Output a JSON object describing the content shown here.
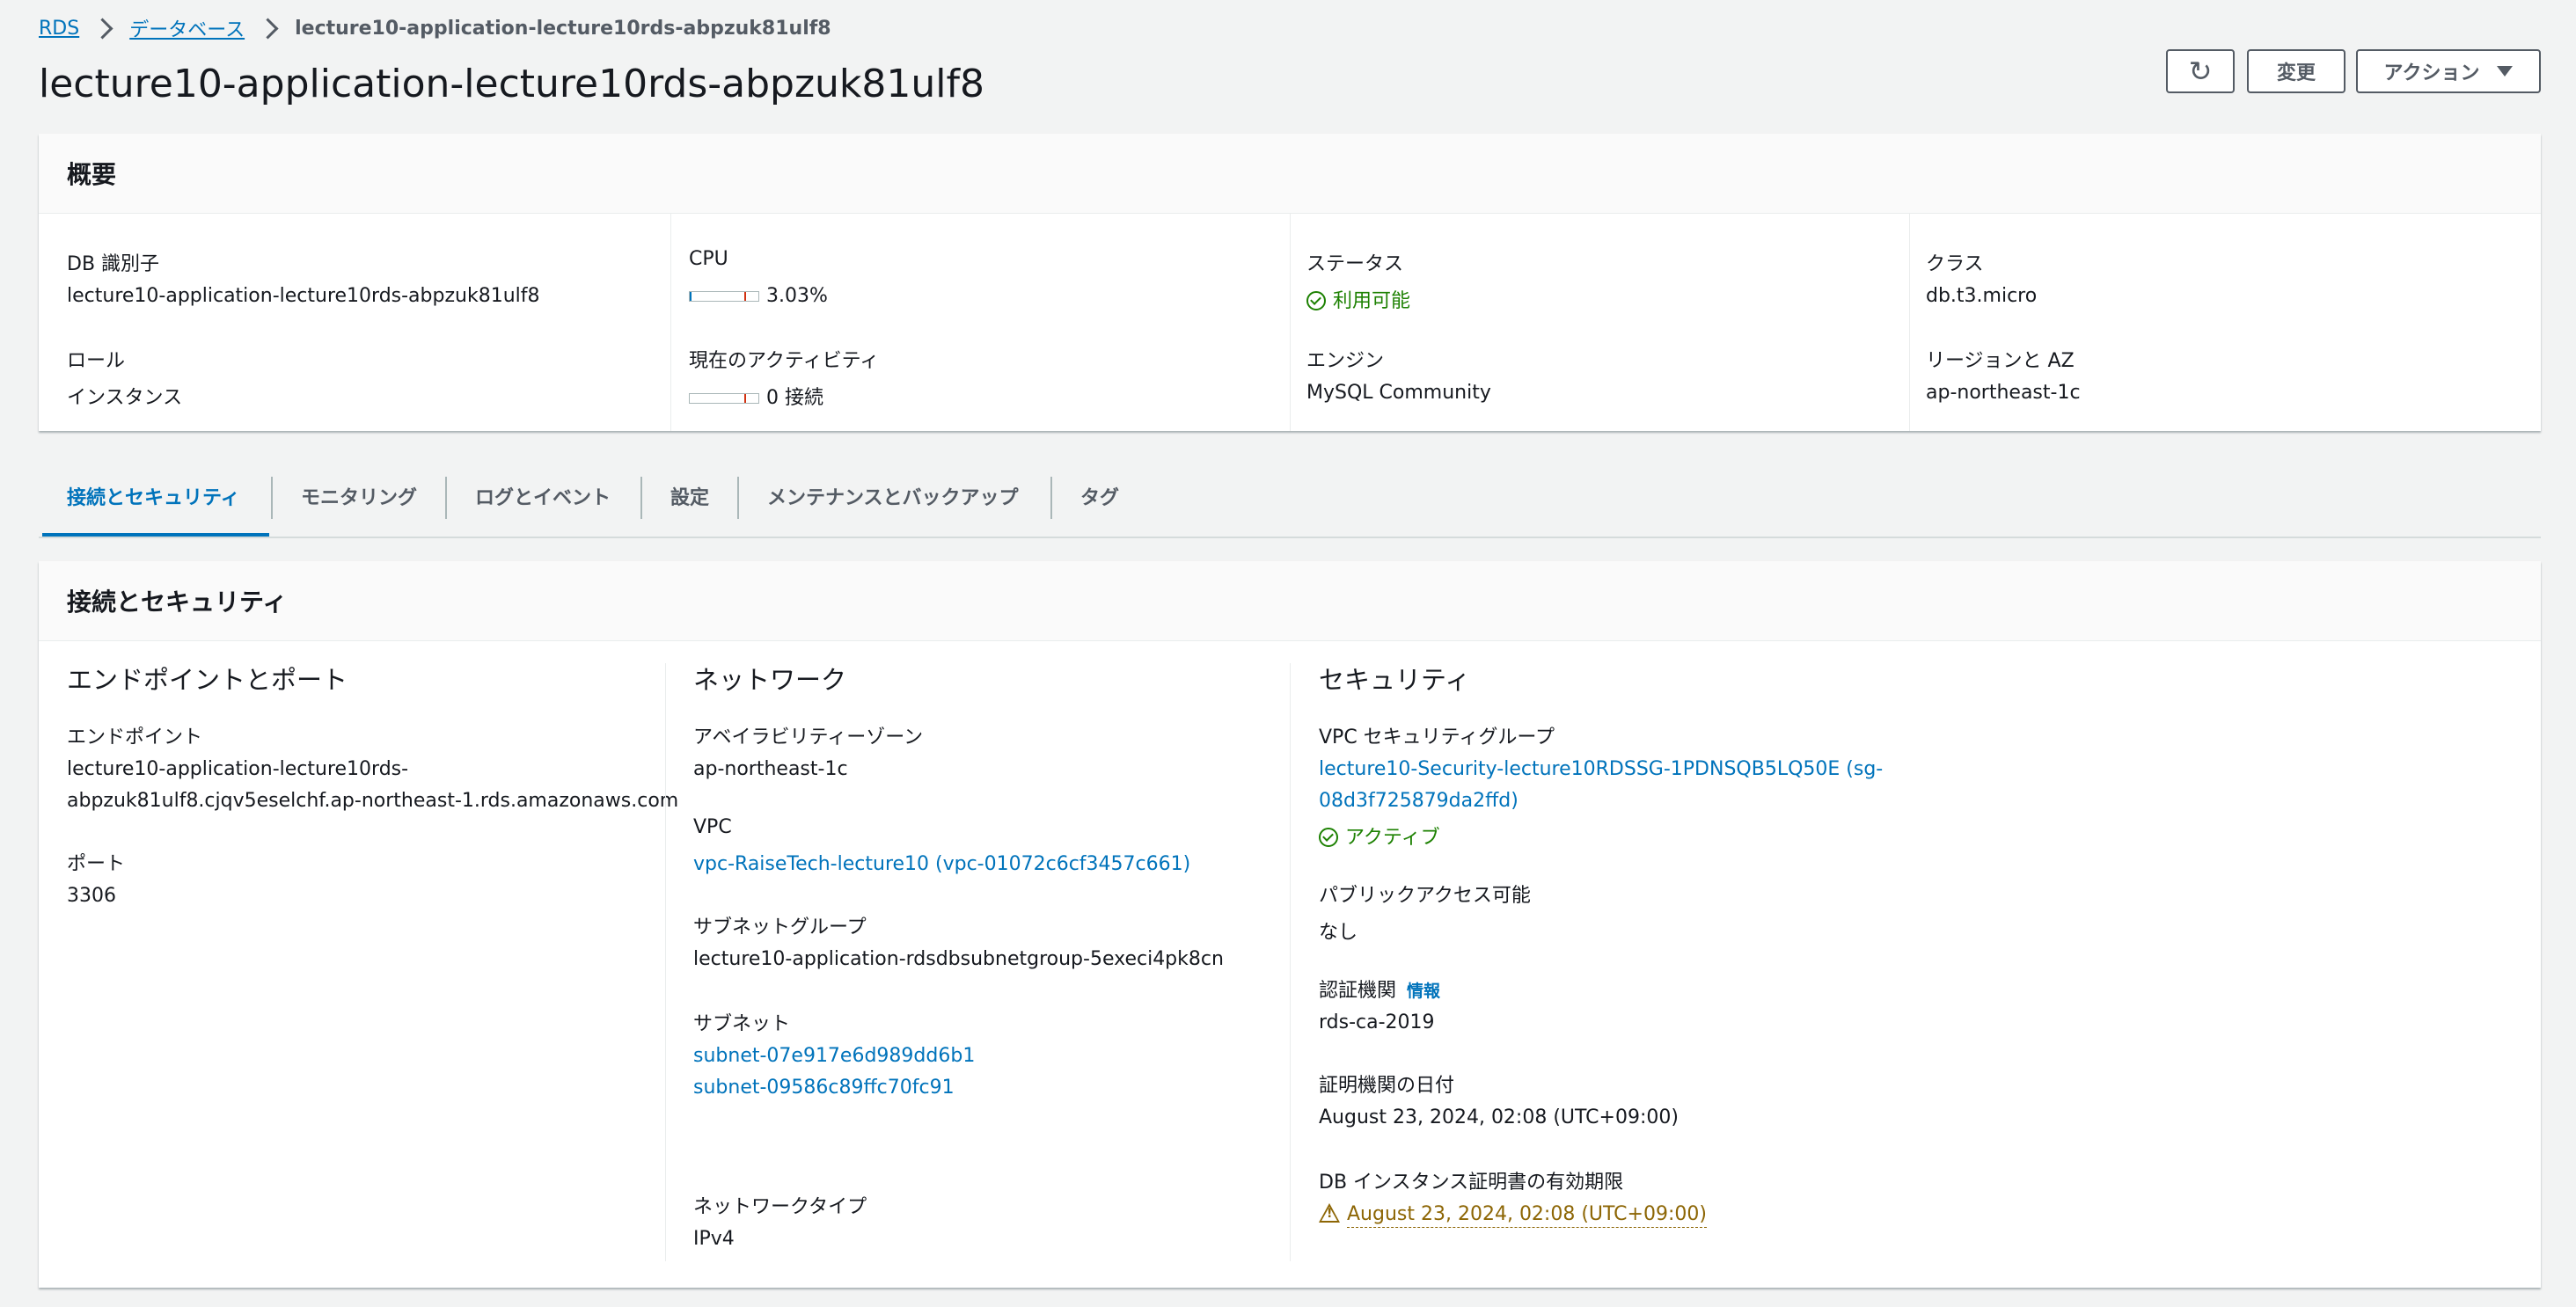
{
  "breadcrumb": {
    "items": [
      "RDS",
      "データベース"
    ],
    "current": "lecture10-application-lecture10rds-abpzuk81ulf8"
  },
  "page_title": "lecture10-application-lecture10rds-abpzuk81ulf8",
  "buttons": {
    "refresh_icon": "refresh-icon",
    "edit": "変更",
    "actions": "アクション"
  },
  "summary": {
    "title": "概要",
    "db_id_label": "DB 識別子",
    "db_id_value": "lecture10-application-lecture10rds-abpzuk81ulf8",
    "role_label": "ロール",
    "role_value": "インスタンス",
    "cpu_label": "CPU",
    "cpu_value": "3.03%",
    "cpu_fraction": 0.0303,
    "activity_label": "現在のアクティビティ",
    "activity_value": "0 接続",
    "activity_fraction": 0,
    "status_label": "ステータス",
    "status_value": "利用可能",
    "engine_label": "エンジン",
    "engine_value": "MySQL Community",
    "class_label": "クラス",
    "class_value": "db.t3.micro",
    "region_label": "リージョンと AZ",
    "region_value": "ap-northeast-1c"
  },
  "tabs": [
    "接続とセキュリティ",
    "モニタリング",
    "ログとイベント",
    "設定",
    "メンテナンスとバックアップ",
    "タグ"
  ],
  "connectivity": {
    "title": "接続とセキュリティ",
    "endpoint_section": {
      "title": "エンドポイントとポート",
      "endpoint_label": "エンドポイント",
      "endpoint_line1": "lecture10-application-lecture10rds-",
      "endpoint_line2": "abpzuk81ulf8.cjqv5eselchf.ap-northeast-1.rds.amazonaws.com",
      "port_label": "ポート",
      "port_value": "3306"
    },
    "network_section": {
      "title": "ネットワーク",
      "az_label": "アベイラビリティーゾーン",
      "az_value": "ap-northeast-1c",
      "vpc_label": "VPC",
      "vpc_value": "vpc-RaiseTech-lecture10 (vpc-01072c6cf3457c661)",
      "subnet_group_label": "サブネットグループ",
      "subnet_group_value": "lecture10-application-rdsdbsubnetgroup-5execi4pk8cn",
      "subnets_label": "サブネット",
      "subnets": [
        "subnet-07e917e6d989dd6b1",
        "subnet-09586c89ffc70fc91"
      ],
      "network_type_label": "ネットワークタイプ",
      "network_type_value": "IPv4"
    },
    "security_section": {
      "title": "セキュリティ",
      "sg_label": "VPC セキュリティグループ",
      "sg_line1": "lecture10-Security-lecture10RDSSG-1PDNSQB5LQ50E (sg-",
      "sg_line2": "08d3f725879da2ffd)",
      "sg_status": "アクティブ",
      "public_label": "パブリックアクセス可能",
      "public_value": "なし",
      "ca_label": "認証機関",
      "ca_info": "情報",
      "ca_value": "rds-ca-2019",
      "ca_date_label": "証明機関の日付",
      "ca_date_value": "August 23, 2024, 02:08 (UTC+09:00)",
      "cert_expiry_label": "DB インスタンス証明書の有効期限",
      "cert_expiry_value": "August 23, 2024, 02:08 (UTC+09:00)"
    }
  },
  "colors": {
    "link": "#0073bb",
    "success": "#1d8102",
    "warning": "#8d6605",
    "background": "#f2f3f3"
  }
}
